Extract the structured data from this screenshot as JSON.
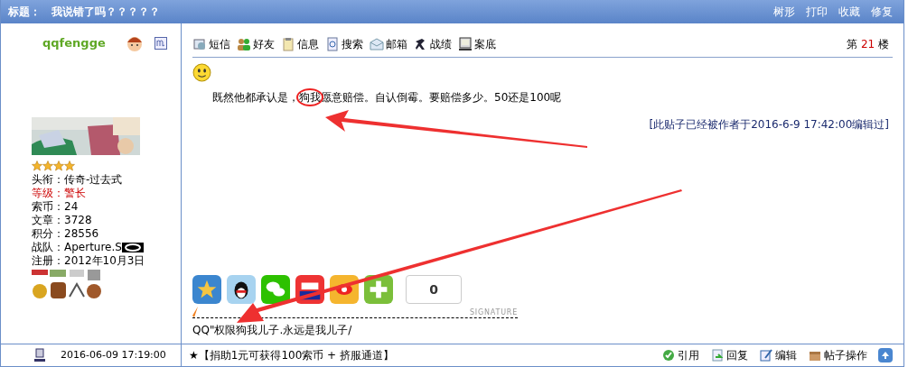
{
  "header": {
    "label": "标题：",
    "title": "我说错了吗？？？？？",
    "links": [
      "树形",
      "打印",
      "收藏",
      "修复"
    ]
  },
  "user": {
    "name": "qqfengge",
    "stars": 4,
    "fields": [
      {
        "label": "头衔：",
        "value": "传奇-过去式",
        "highlight": false
      },
      {
        "label": "等级：",
        "value": "警长",
        "highlight": true
      },
      {
        "label": "索币：",
        "value": "24",
        "highlight": false
      },
      {
        "label": "文章：",
        "value": "3728",
        "highlight": false
      },
      {
        "label": "积分：",
        "value": "28556",
        "highlight": false
      },
      {
        "label": "战队：",
        "value": "Aperture.S",
        "highlight": false
      },
      {
        "label": "注册：",
        "value": "2012年10月3日",
        "highlight": false
      }
    ]
  },
  "toolbar": [
    {
      "kind": "message",
      "label": "短信"
    },
    {
      "kind": "friends",
      "label": "好友"
    },
    {
      "kind": "info",
      "label": "信息"
    },
    {
      "kind": "search",
      "label": "搜索"
    },
    {
      "kind": "mail",
      "label": "邮箱"
    },
    {
      "kind": "record",
      "label": "战绩"
    },
    {
      "kind": "case",
      "label": "案底"
    }
  ],
  "floor": {
    "prefix": "第",
    "number": "21",
    "suffix": "楼"
  },
  "post": {
    "before": "既然他都承认是，",
    "circled": "狗我",
    "after": "愿意赔偿。自认倒霉。要赔偿多少。50还是100呢",
    "edit_note": "[此贴子已经被作者于2016-6-9 17:42:00编辑过]"
  },
  "share": {
    "count": "0",
    "buttons": [
      {
        "kind": "qzone"
      },
      {
        "kind": "qq"
      },
      {
        "kind": "wechat"
      },
      {
        "kind": "bookmark"
      },
      {
        "kind": "weibo"
      },
      {
        "kind": "more"
      }
    ]
  },
  "signature": {
    "label": "SIGNATURE",
    "text": "QQ\"权限狗我儿子.永远是我儿子/"
  },
  "footer": {
    "time": "2016-06-09 17:19:00",
    "notice": "★【捐助1元可获得100索币 + 挤服通道】",
    "actions": [
      {
        "kind": "quote",
        "label": "引用"
      },
      {
        "kind": "reply",
        "label": "回复"
      },
      {
        "kind": "edit",
        "label": "编辑"
      },
      {
        "kind": "manage",
        "label": "帖子操作"
      }
    ]
  }
}
